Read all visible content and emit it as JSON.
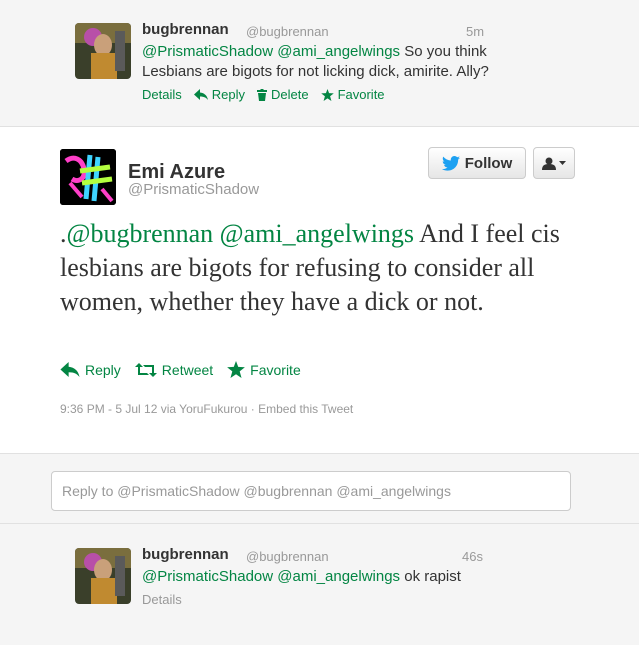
{
  "top_tweet": {
    "name": "bugbrennan",
    "handle": "@bugbrennan",
    "time": "5m",
    "mentions": "@PrismaticShadow @ami_angelwings",
    "text_rest_line1": " So you think",
    "text_line2": "Lesbians are bigots for not licking dick, amirite. Ally?",
    "actions": {
      "details": "Details",
      "reply": "Reply",
      "delete": "Delete",
      "favorite": "Favorite"
    }
  },
  "main_tweet": {
    "name": "Emi Azure",
    "handle": "@PrismaticShadow",
    "follow_label": "Follow",
    "text_prefix": ".",
    "mentions": "@bugbrennan @ami_angelwings",
    "text_rest": " And I feel cis lesbians are bigots for refusing to consider all women, whether they have a dick or not.",
    "actions": {
      "reply": "Reply",
      "retweet": "Retweet",
      "favorite": "Favorite"
    },
    "meta": "9:36 PM - 5 Jul 12 via YoruFukurou · Embed this Tweet"
  },
  "reply_box": {
    "value": "Reply to @PrismaticShadow @bugbrennan @ami_angelwings"
  },
  "bottom_tweet": {
    "name": "bugbrennan",
    "handle": "@bugbrennan",
    "time": "46s",
    "mentions": "@PrismaticShadow @ami_angelwings",
    "text_rest": " ok rapist",
    "details": "Details"
  },
  "colors": {
    "link": "#038543",
    "twitter_blue": "#1da1f2",
    "muted": "#999999"
  }
}
